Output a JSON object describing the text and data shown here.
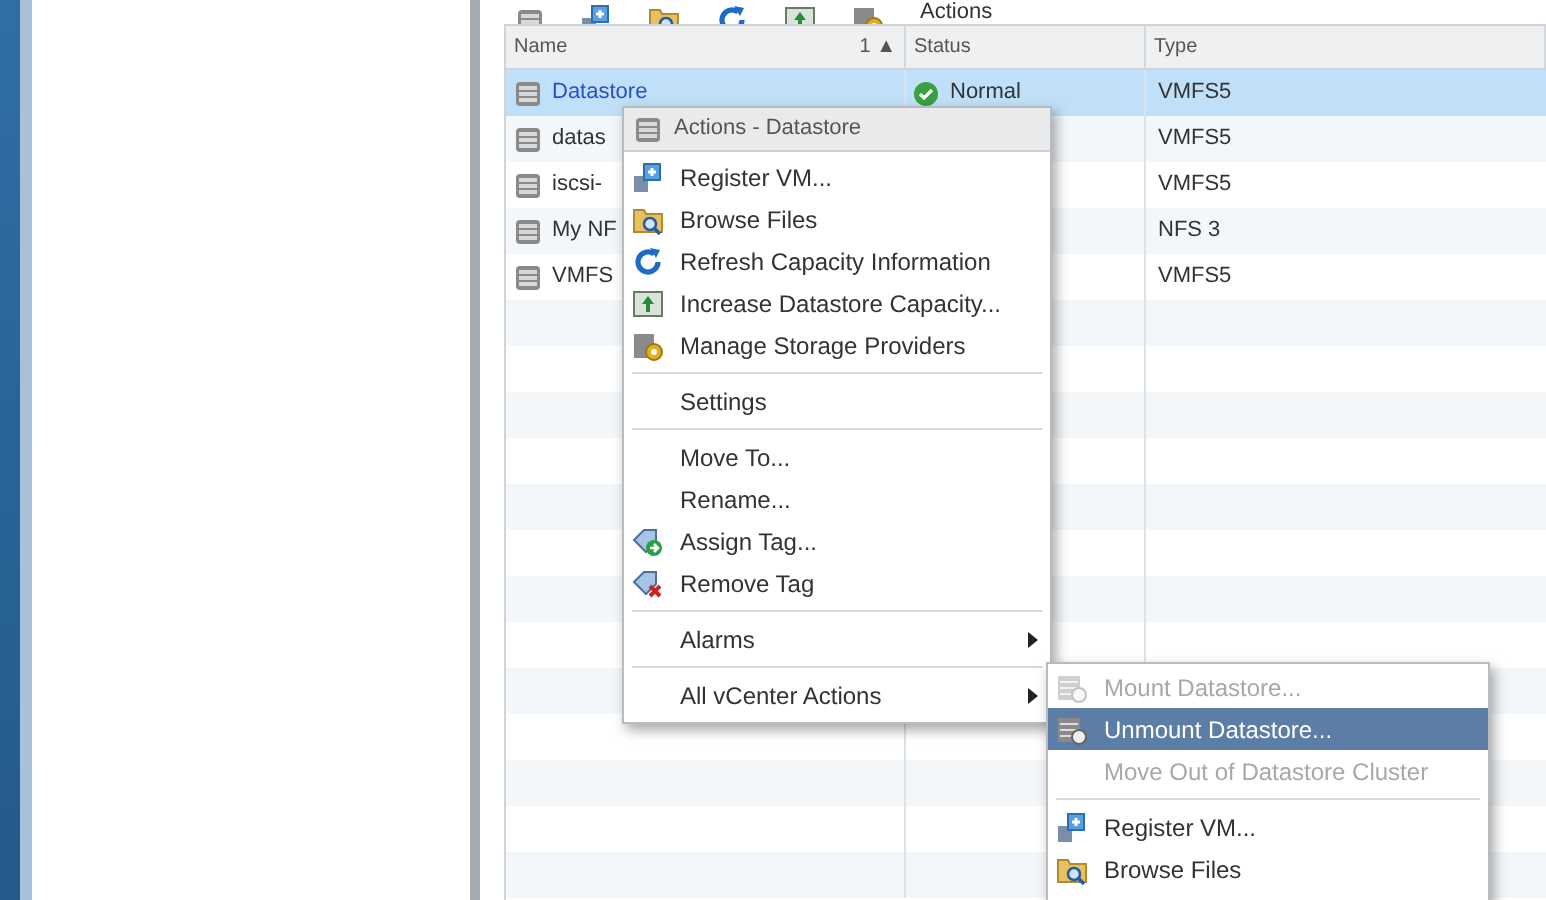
{
  "toolbar": {
    "actions_label": "Actions"
  },
  "table": {
    "columns": [
      {
        "label": "Name",
        "sort": "1 ▲"
      },
      {
        "label": "Status"
      },
      {
        "label": "Type"
      }
    ],
    "rows": [
      {
        "name": "Datastore",
        "status": "Normal",
        "type": "VMFS5",
        "selected": true
      },
      {
        "name": "datas",
        "type": "VMFS5",
        "selected": false
      },
      {
        "name": "iscsi-",
        "type": "VMFS5",
        "selected": false
      },
      {
        "name": "My NF",
        "type": "NFS 3",
        "selected": false
      },
      {
        "name": "VMFS",
        "type": "VMFS5",
        "selected": false
      }
    ]
  },
  "context_menu": {
    "title": "Actions - Datastore",
    "items": [
      {
        "kind": "item",
        "label": "Register VM..."
      },
      {
        "kind": "item",
        "label": "Browse Files"
      },
      {
        "kind": "item",
        "label": "Refresh Capacity Information"
      },
      {
        "kind": "item",
        "label": "Increase Datastore Capacity..."
      },
      {
        "kind": "item",
        "label": "Manage Storage Providers"
      },
      {
        "kind": "separator"
      },
      {
        "kind": "item",
        "label": "Settings"
      },
      {
        "kind": "separator"
      },
      {
        "kind": "item",
        "label": "Move To..."
      },
      {
        "kind": "item",
        "label": "Rename..."
      },
      {
        "kind": "item",
        "label": "Assign Tag..."
      },
      {
        "kind": "item",
        "label": "Remove Tag"
      },
      {
        "kind": "separator"
      },
      {
        "kind": "submenu",
        "label": "Alarms"
      },
      {
        "kind": "separator"
      },
      {
        "kind": "submenu",
        "label": "All vCenter Actions"
      }
    ]
  },
  "submenu": {
    "items": [
      {
        "kind": "item",
        "label": "Mount Datastore...",
        "disabled": true,
        "selected": false
      },
      {
        "kind": "item",
        "label": "Unmount Datastore...",
        "disabled": false,
        "selected": true
      },
      {
        "kind": "item",
        "label": "Move Out of Datastore Cluster",
        "disabled": true,
        "selected": false
      },
      {
        "kind": "separator"
      },
      {
        "kind": "item",
        "label": "Register VM...",
        "disabled": false,
        "selected": false
      },
      {
        "kind": "item",
        "label": "Browse Files",
        "disabled": false,
        "selected": false
      }
    ]
  }
}
